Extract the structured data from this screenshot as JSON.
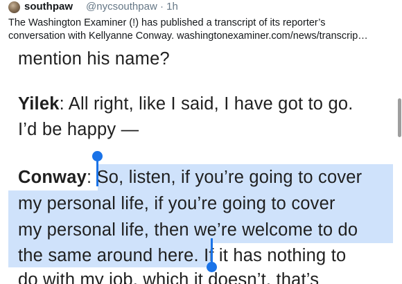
{
  "tweet": {
    "display_name": "southpaw",
    "handle_time": "@nycsouthpaw · 1h",
    "text_line1": "The Washington Examiner (!) has published a transcript of its reporter’s",
    "text_line2": "conversation with Kellyanne Conway.  washingtonexaminer.com/news/transcrip…"
  },
  "transcript": {
    "line0": "mention his name?",
    "yilek_speaker": "Yilek",
    "yilek_rest": ": All right, like I said, I have got to go.",
    "yilek_line2": "I’d be happy —",
    "conway_speaker": "Conway",
    "conway_colon": ":",
    "conway_l1": "So, listen, if you’re going to cover",
    "conway_l2": "my personal life, if you’re going to cover",
    "conway_l3": "my personal life, then we’re welcome to do",
    "conway_l4_selected": "the same around here.",
    "conway_l4_rest": " If it has nothing to",
    "conway_l5": "do with my job, which it doesn’t, that’s"
  },
  "colors": {
    "selection": "#cfe2fb",
    "handle": "#1a73e8"
  }
}
